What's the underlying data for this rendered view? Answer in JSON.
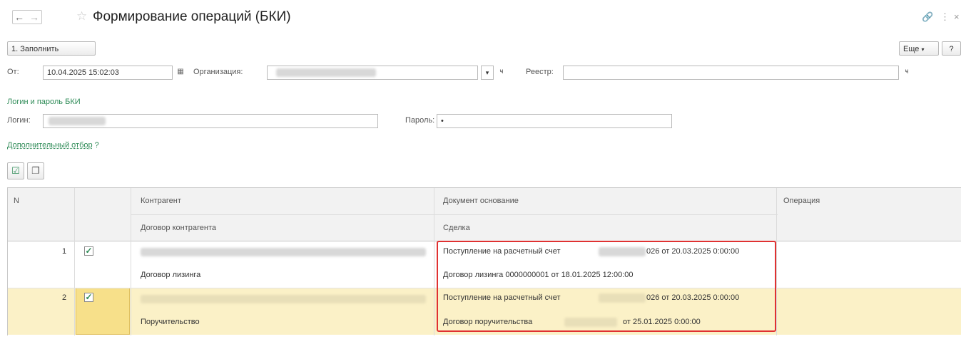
{
  "header": {
    "title": "Формирование операций (БКИ)",
    "back_icon": "arrow-left-icon",
    "forward_icon": "arrow-right-icon",
    "favorite_icon": "star-icon",
    "link_icon": "link-icon",
    "more_vert_icon": "kebab-icon",
    "close_icon": "close-icon"
  },
  "toolbar": {
    "fill_label": "1. Заполнить",
    "more_label": "Еще",
    "help_label": "?"
  },
  "filters": {
    "from_label": "От:",
    "from_value": "10.04.2025 15:02:03",
    "org_label": "Организация:",
    "registry_label": "Реестр:"
  },
  "credentials": {
    "section_title": "Логин и пароль БКИ",
    "login_label": "Логин:",
    "password_label": "Пароль:",
    "password_value": "•"
  },
  "extra_filter": {
    "label": "Дополнительный отбор",
    "help": "?"
  },
  "table": {
    "headers": {
      "n": "N",
      "counterparty": "Контрагент",
      "base_doc": "Документ основание",
      "operation": "Операция",
      "contract": "Договор контрагента",
      "deal": "Сделка"
    },
    "rows": [
      {
        "n": "1",
        "checked": "✓",
        "contract": "Договор лизинга",
        "base_doc_prefix": "Поступление на расчетный счет",
        "base_doc_suffix": "026 от 20.03.2025 0:00:00",
        "deal": "Договор лизинга 0000000001 от 18.01.2025 12:00:00"
      },
      {
        "n": "2",
        "checked": "✓",
        "contract": "Поручительство",
        "base_doc_prefix": "Поступление на расчетный счет",
        "base_doc_suffix": "026 от 20.03.2025 0:00:00",
        "deal_prefix": "Договор поручительства",
        "deal_suffix": "от 25.01.2025 0:00:00"
      }
    ]
  },
  "colors": {
    "accent_green": "#2e8b57",
    "selected_row": "#fbf1c7",
    "selected_cell": "#f7e08a",
    "highlight_border": "#e03131"
  }
}
